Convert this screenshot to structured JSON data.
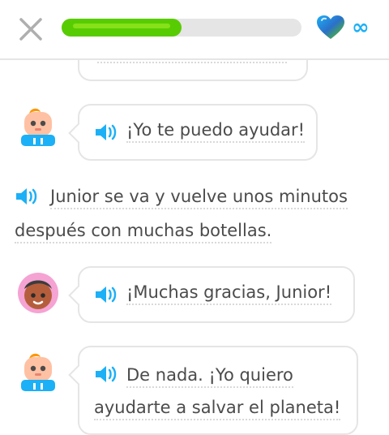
{
  "header": {
    "progress_fraction": 0.5,
    "infinity_symbol": "∞",
    "colors": {
      "progress": "#58cc02",
      "infinity": "#1cb0f6"
    }
  },
  "dialogue": [
    {
      "speaker": "junior",
      "text": "¡Yo te puedo ayudar!"
    },
    {
      "narration_line1": "Junior se va y vuelve unos minutos",
      "narration_line2": "después con muchas botellas."
    },
    {
      "speaker": "lily",
      "text": "¡Muchas gracias, Junior!"
    },
    {
      "speaker": "junior",
      "text_line1": "De nada. ¡Yo quiero",
      "text_line2": "ayudarte a salvar el planeta!"
    }
  ]
}
